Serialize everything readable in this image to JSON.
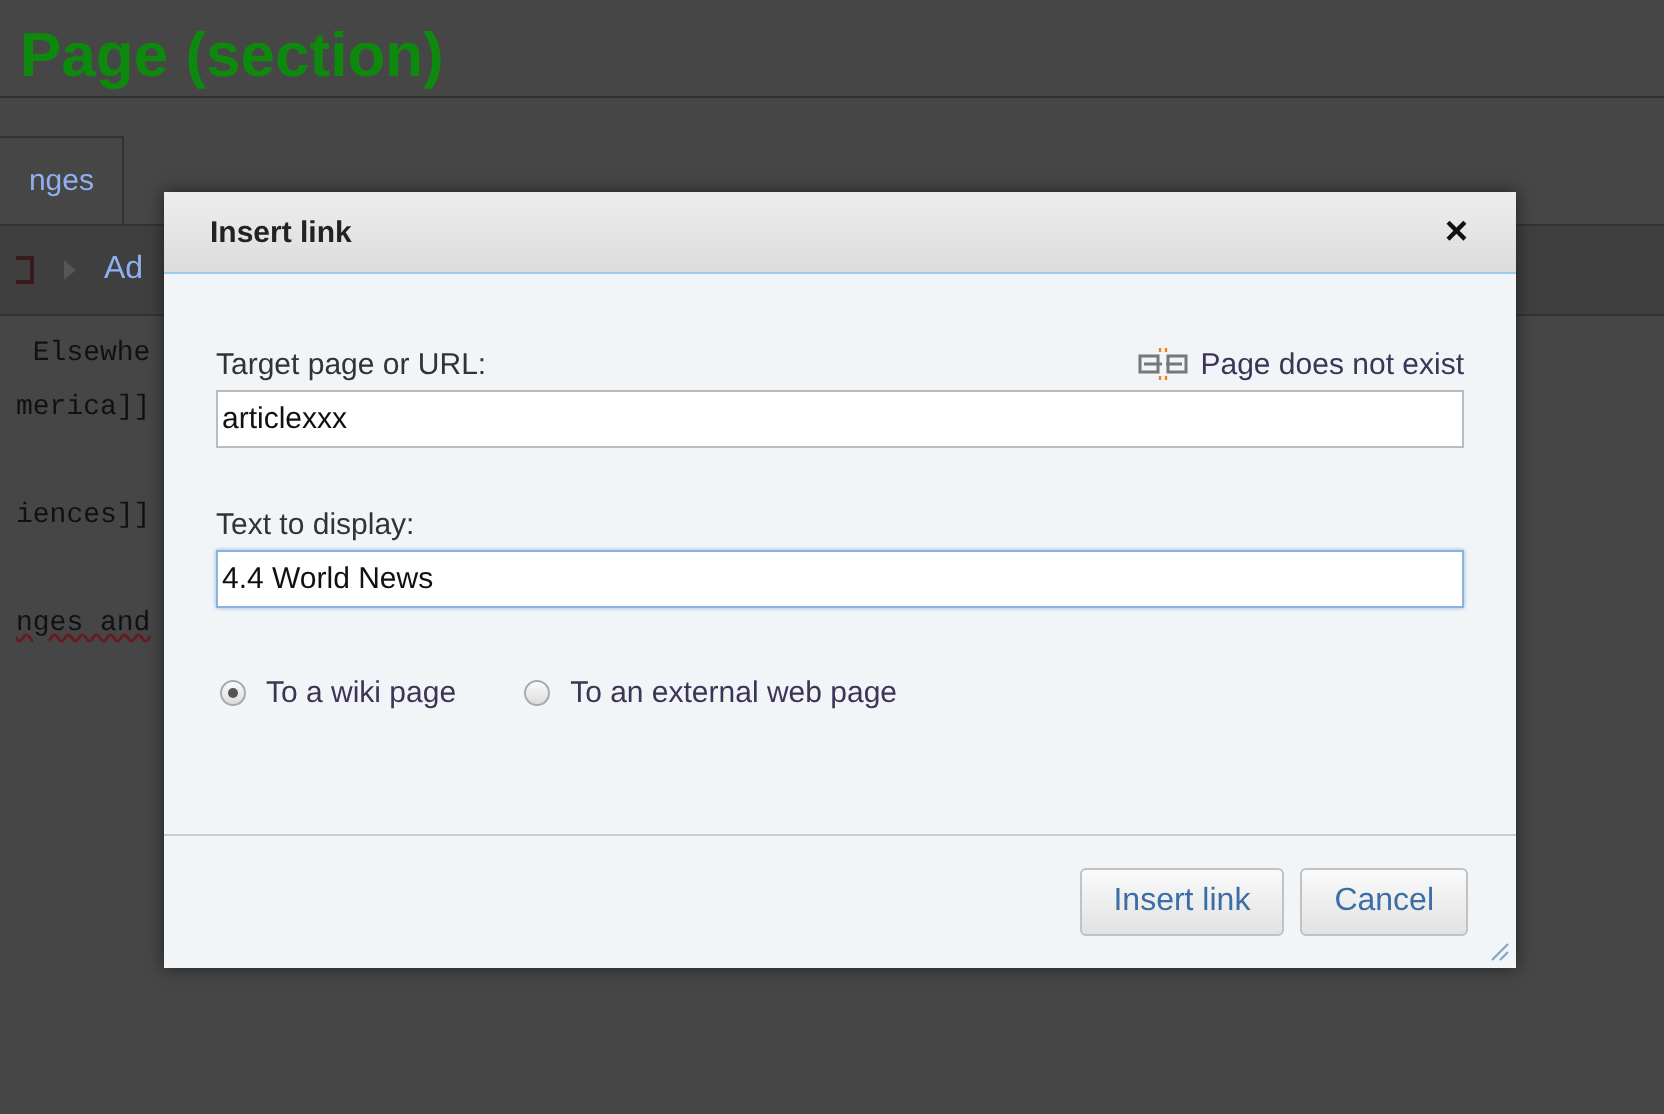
{
  "page": {
    "heading": "Page (section)",
    "tab": "nges",
    "toolbar_link": "Ad",
    "source_lines": [
      " Elsewhe",
      "merica]]",
      "iences]]",
      "nges and"
    ]
  },
  "dialog": {
    "title": "Insert link",
    "close": "×",
    "target_label": "Target page or URL:",
    "status": "Page does not exist",
    "target_value": "articlexxx",
    "display_label": "Text to display:",
    "display_value": "4.4 World News",
    "display_focused": true,
    "options": [
      {
        "label": "To a wiki page",
        "selected": true
      },
      {
        "label": "To an external web page",
        "selected": false
      }
    ],
    "buttons": [
      "Insert link",
      "Cancel"
    ]
  }
}
